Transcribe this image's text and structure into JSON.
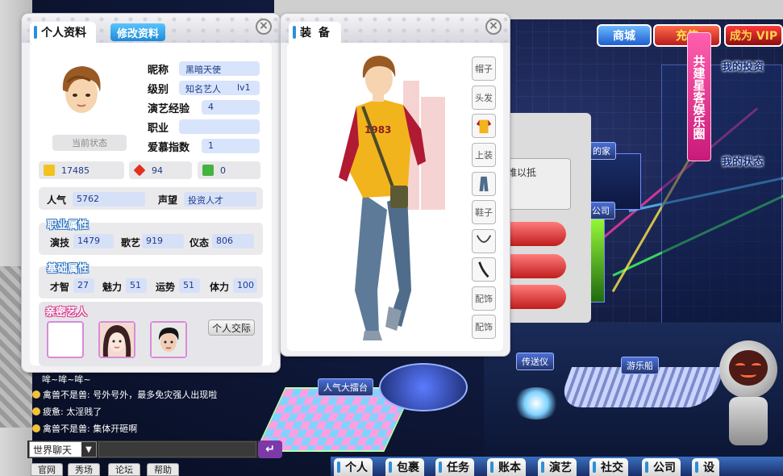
{
  "topright": {
    "shop": "商城",
    "recharge": "充值",
    "vip": "成为 VIP",
    "vip_band": "共建星客娱乐圈",
    "my_invest": "我的投资",
    "my_status": "我的状态"
  },
  "map_labels": {
    "home": "的家",
    "company": "公司",
    "stage": "人气大擂台",
    "teleporter": "传送仪",
    "cruise": "游乐船"
  },
  "profile": {
    "tab": "个人资料",
    "edit_tab": "修改资料",
    "current_status": "当前状态",
    "fields": [
      {
        "label": "昵称",
        "value": "黑暗天使"
      },
      {
        "label": "级别",
        "value": "知名艺人",
        "extra": "lv1"
      },
      {
        "label": "演艺经验",
        "value": "4"
      },
      {
        "label": "职业",
        "value": ""
      },
      {
        "label": "爱慕指数",
        "value": "1"
      }
    ],
    "currency": {
      "gold": "17485",
      "gem": "94",
      "cash": "0"
    },
    "popularity": {
      "label": "人气",
      "value": "5762"
    },
    "reputation": {
      "label": "声望",
      "value": "投资人才"
    },
    "career_title": "职业属性",
    "career": [
      {
        "label": "演技",
        "value": "1479"
      },
      {
        "label": "歌艺",
        "value": "919"
      },
      {
        "label": "仪态",
        "value": "806"
      }
    ],
    "basic_title": "基础属性",
    "basic": [
      {
        "label": "才智",
        "value": "27"
      },
      {
        "label": "魅力",
        "value": "51"
      },
      {
        "label": "运势",
        "value": "51"
      },
      {
        "label": "体力",
        "value": "100"
      }
    ],
    "friends_title": "亲密艺人",
    "social_button": "个人交际"
  },
  "equipment": {
    "tab": "装 备",
    "shirt_text": "1983",
    "slots": [
      "帽子",
      "头发",
      "",
      "上装",
      "",
      "鞋子",
      "",
      "",
      "配饰",
      "配饰"
    ]
  },
  "bgdialog": {
    "text1": "的",
    "text2": "张，难以抵"
  },
  "chat": {
    "lines": [
      {
        "text": "哞~哞~哞~",
        "icon": false
      },
      {
        "text": "禽兽不是兽: 号外号外，最多免灾强人出现啦",
        "icon": true
      },
      {
        "text": "疲惫: 太淫贱了",
        "icon": true
      },
      {
        "text": "禽兽不是兽: 集体开砸啊",
        "icon": true
      }
    ],
    "channel": "世界聊天",
    "send_icon": "↵"
  },
  "links": [
    "官网",
    "秀场",
    "论坛",
    "帮助"
  ],
  "nav": [
    "个人",
    "包裹",
    "任务",
    "账本",
    "演艺",
    "社交",
    "公司",
    "设"
  ],
  "colors": {
    "accent": "#2c8fd8",
    "pink": "#d63a8c",
    "vip": "#ff5fae"
  }
}
